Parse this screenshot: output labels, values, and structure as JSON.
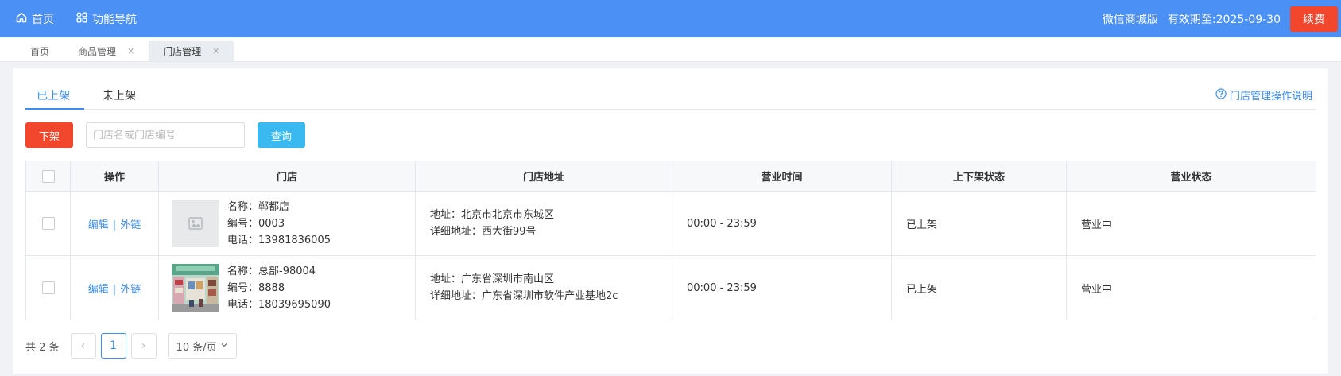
{
  "topbar": {
    "home_label": "首页",
    "func_nav_label": "功能导航",
    "edition": "微信商城版",
    "validity": "有效期至:2025-09-30",
    "renew_label": "续费",
    "bg_color": "#4a90f5",
    "home_icon": "home-icon",
    "func_nav_icon": "grid-icon"
  },
  "page_tabs": [
    {
      "label": "首页",
      "closable": false,
      "active": false
    },
    {
      "label": "商品管理",
      "closable": true,
      "active": false
    },
    {
      "label": "门店管理",
      "closable": true,
      "active": true
    }
  ],
  "sub_tabs": {
    "on_shelf": "已上架",
    "off_shelf": "未上架",
    "help": "门店管理操作说明"
  },
  "toolbar": {
    "take_down_label": "下架",
    "search_placeholder": "门店名或门店编号",
    "search_value": "",
    "query_label": "查询"
  },
  "table": {
    "headers": {
      "operation": "操作",
      "store": "门店",
      "address": "门店地址",
      "hours": "营业时间",
      "shelf_status": "上下架状态",
      "business_status": "营业状态"
    },
    "rows": [
      {
        "edit": "编辑",
        "sep": "|",
        "link": "外链",
        "name": "名称：郸都店",
        "code": "编号：0003",
        "phone": "电话：13981836005",
        "address": "地址：北京市北京市东城区",
        "detail": "详细地址：西大街99号",
        "hours": "00:00 - 23:59",
        "shelf": "已上架",
        "status": "营业中",
        "image": "placeholder-image-icon"
      },
      {
        "edit": "编辑",
        "sep": "|",
        "link": "外链",
        "name": "名称：总部-98004",
        "code": "编号：8888",
        "phone": "电话：18039695090",
        "address": "地址：广东省深圳市南山区",
        "detail": "详细地址：广东省深圳市软件产业基地2c",
        "hours": "00:00 - 23:59",
        "shelf": "已上架",
        "status": "营业中",
        "image": "store-photo"
      }
    ]
  },
  "pagination": {
    "total": "共 2 条",
    "prev": "‹",
    "page": "1",
    "next": "›",
    "page_size": "10 条/页"
  },
  "colors": {
    "accent": "#3d8ef0",
    "danger": "#f2462d",
    "query": "#3ab8f0"
  }
}
